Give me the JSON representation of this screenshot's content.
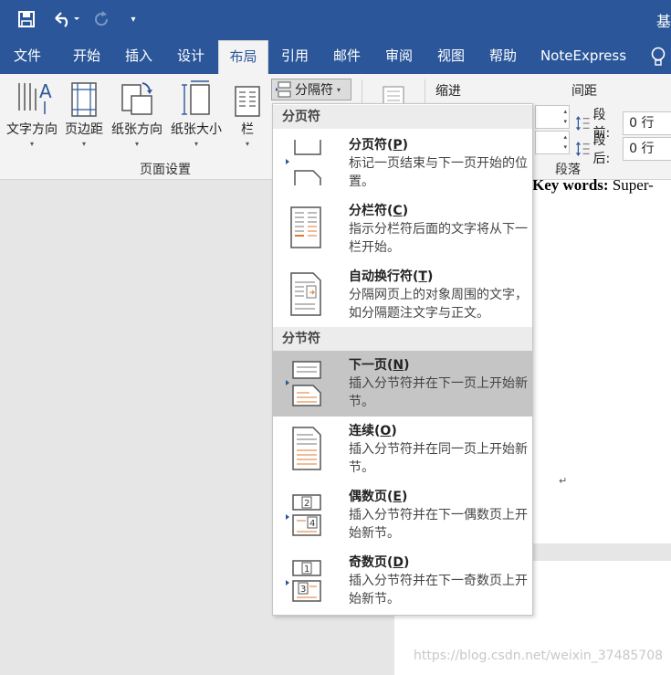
{
  "titlebar": {
    "title_fragment": "基"
  },
  "tabs": [
    {
      "label": "文件"
    },
    {
      "label": "开始"
    },
    {
      "label": "插入"
    },
    {
      "label": "设计"
    },
    {
      "label": "布局"
    },
    {
      "label": "引用"
    },
    {
      "label": "邮件"
    },
    {
      "label": "审阅"
    },
    {
      "label": "视图"
    },
    {
      "label": "帮助"
    },
    {
      "label": "NoteExpress"
    }
  ],
  "active_tab": "布局",
  "ribbon": {
    "text_direction": "文字方向",
    "margins": "页边距",
    "orientation": "纸张方向",
    "size": "纸张大小",
    "columns": "栏",
    "breaks": "分隔符",
    "page_setup_group": "页面设置",
    "indent_label": "缩进",
    "spacing_label": "间距",
    "before_label": "段前:",
    "before_value": "0 行",
    "after_label": "段后:",
    "after_value": "0 行",
    "paragraph_group": "段落"
  },
  "menu": {
    "page_breaks_header": "分页符",
    "section_breaks_header": "分节符",
    "items": [
      {
        "title": "分页符",
        "key": "P",
        "desc": "标记一页结束与下一页开始的位置。"
      },
      {
        "title": "分栏符",
        "key": "C",
        "desc": "指示分栏符后面的文字将从下一栏开始。"
      },
      {
        "title": "自动换行符",
        "key": "T",
        "desc": "分隔网页上的对象周围的文字，如分隔题注文字与正文。"
      },
      {
        "title": "下一页",
        "key": "N",
        "desc": "插入分节符并在下一页上开始新节。"
      },
      {
        "title": "连续",
        "key": "O",
        "desc": "插入分节符并在同一页上开始新节。"
      },
      {
        "title": "偶数页",
        "key": "E",
        "desc": "插入分节符并在下一偶数页上开始新节。"
      },
      {
        "title": "奇数页",
        "key": "D",
        "desc": "插入分节符并在下一奇数页上开始新节。"
      }
    ],
    "highlighted": "下一页"
  },
  "document": {
    "keywords_label": "Key words:",
    "keywords_text": " Super-",
    "paragraph_mark": "↵"
  },
  "watermark": "https://blog.csdn.net/weixin_37485708",
  "colors": {
    "accent": "#2b579a",
    "ribbon_bg": "#f3f3f3",
    "highlight": "#c5c5c5",
    "icon_orange": "#e07a2e"
  }
}
